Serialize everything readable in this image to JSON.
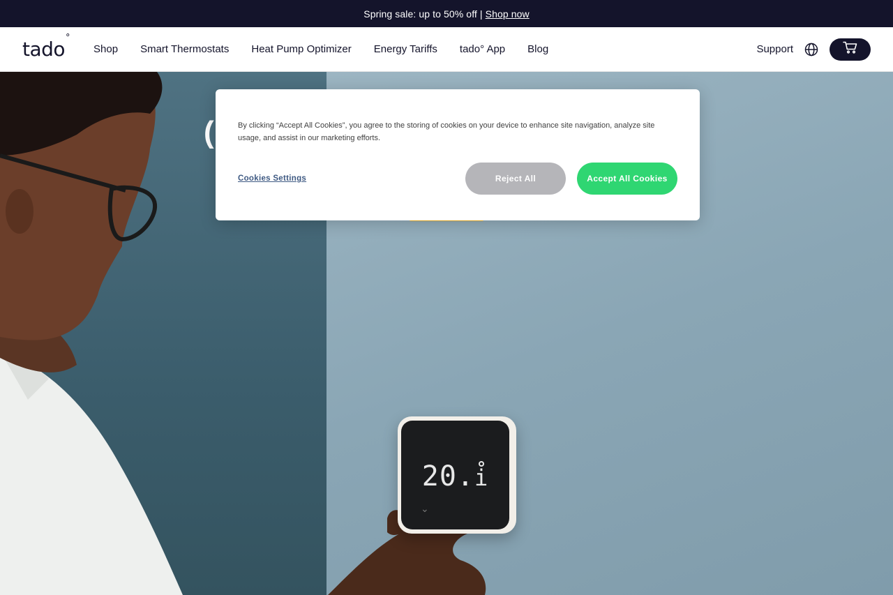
{
  "promo": {
    "text": "Spring sale: up to 50% off |",
    "link": "Shop now"
  },
  "nav": {
    "logo": "tado",
    "logo_mark": "°",
    "links": [
      "Shop",
      "Smart Thermostats",
      "Heat Pump Optimizer",
      "Energy Tariffs",
      "tado° App",
      "Blog"
    ],
    "support": "Support",
    "globe_icon": "globe-icon",
    "cart_icon": "cart-icon"
  },
  "hero": {
    "thermostat_temp": "20.",
    "thermostat_decimal": "i"
  },
  "cookie_banner": {
    "text": "By clicking “Accept All Cookies”, you agree to the storing of cookies on your device to enhance site navigation, analyze site usage, and assist in our marketing efforts.",
    "settings_label": "Cookies Settings",
    "reject_label": "Reject All",
    "accept_label": "Accept All Cookies"
  },
  "colors": {
    "dark": "#14142b",
    "accept_green": "#2fd672",
    "reject_gray": "#b5b5b9"
  }
}
